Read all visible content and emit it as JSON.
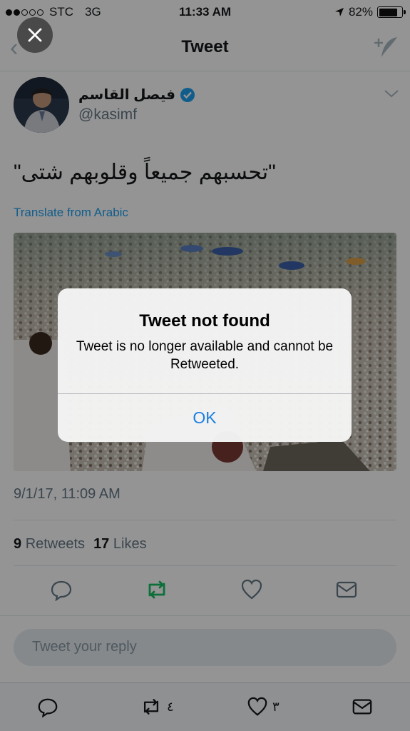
{
  "status_bar": {
    "carrier": "STC",
    "network": "3G",
    "time": "11:33 AM",
    "battery": "82%",
    "battery_level": 0.82
  },
  "nav": {
    "title": "Tweet",
    "back_icon": "chevron-left-icon",
    "compose_icon": "compose-tweet-icon"
  },
  "tweet": {
    "author_name": "فيصل القاسم",
    "verified_icon": "verified-badge-icon",
    "handle": "@kasimf",
    "text": "\"تحسبهم جميعاً وقلوبهم شتى\"",
    "translate_label": "Translate from Arabic",
    "timestamp": "9/1/17, 11:09 AM",
    "retweets_count": "9",
    "retweets_label": "Retweets",
    "likes_count": "17",
    "likes_label": "Likes"
  },
  "reply": {
    "placeholder": "Tweet your reply"
  },
  "tabbar": {
    "retweet_count": "٤",
    "like_count": "٣"
  },
  "alert": {
    "title": "Tweet not found",
    "message": "Tweet is no longer available and cannot be Retweeted.",
    "ok_label": "OK"
  },
  "colors": {
    "accent": "#1da1f2",
    "retweet": "#17bf63",
    "alert_button": "#1a7fe0"
  }
}
